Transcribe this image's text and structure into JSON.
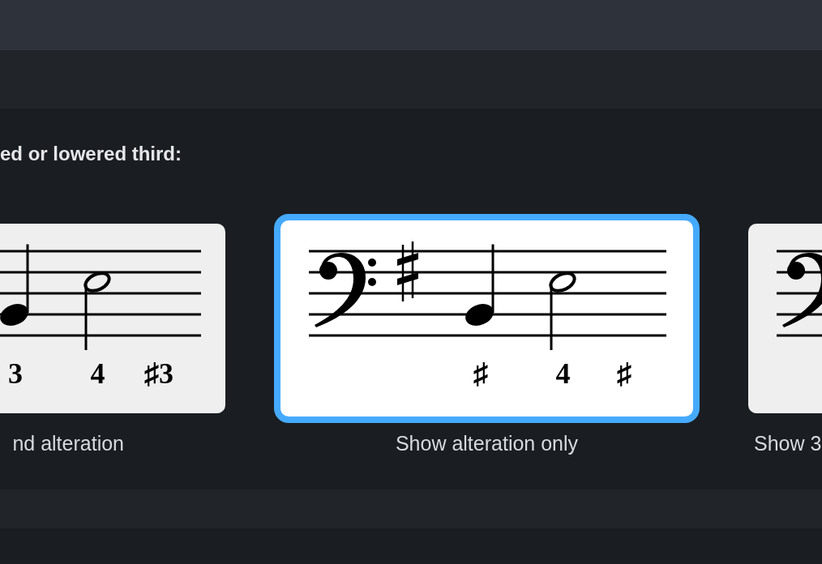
{
  "options": {
    "heading": "ed or lowered third:",
    "cards": [
      {
        "label": "nd alteration",
        "selected": false,
        "figures": [
          "3",
          "4",
          "♯3"
        ]
      },
      {
        "label": "Show alteration only",
        "selected": true,
        "figures": [
          "♯",
          "4",
          "♯"
        ]
      },
      {
        "label": "Show 3",
        "selected": false
      }
    ]
  }
}
